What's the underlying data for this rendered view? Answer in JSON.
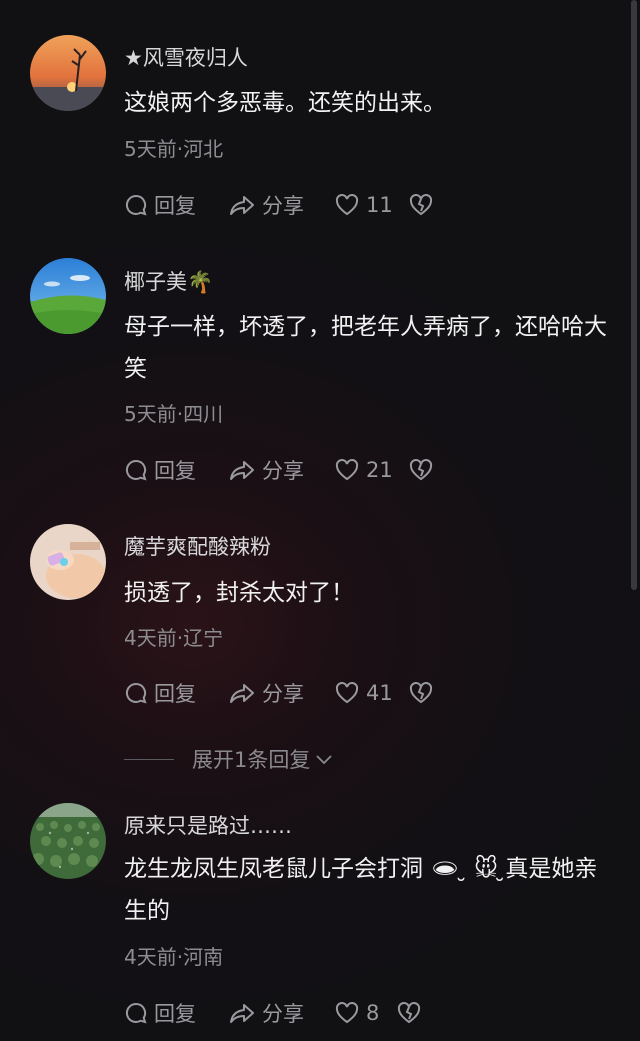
{
  "comments": [
    {
      "username": "★风雪夜归人",
      "text": "这娘两个多恶毒。还笑的出来。",
      "meta": "5天前·河北",
      "reply_label": "回复",
      "share_label": "分享",
      "likes": "11"
    },
    {
      "username": "椰子美🌴",
      "text": "母子一样，坏透了，把老年人弄病了，还哈哈大笑",
      "meta": "5天前·四川",
      "reply_label": "回复",
      "share_label": "分享",
      "likes": "21"
    },
    {
      "username": "魔芋爽配酸辣粉",
      "text": "损透了，封杀太对了！",
      "meta": "4天前·辽宁",
      "reply_label": "回复",
      "share_label": "分享",
      "likes": "41"
    },
    {
      "username": "原来只是路过……",
      "text": "龙生龙凤生凤老鼠儿子会打洞 🕳 ̮ 🐭 ̮真是她亲生的",
      "meta": "4天前·河南",
      "reply_label": "回复",
      "share_label": "分享",
      "likes": "8"
    }
  ],
  "expand_replies": "展开1条回复"
}
